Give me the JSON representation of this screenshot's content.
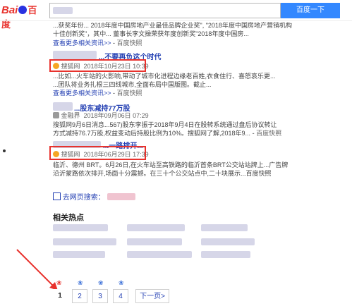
{
  "header": {
    "logo_bai": "Bai",
    "logo_paw": "du",
    "logo_cn": "百度",
    "search_button": "百度一下"
  },
  "results": [
    {
      "snippet_line1": "...获奖年份... 2018年度中国房地产业最佳品牌企业奖\", \"2018年度中国房地产营销机构",
      "snippet_line2": "十佳创新奖\"，其中... 董事长李文操荣获年度创新奖\"2018年度中国房...",
      "more_label": "查看更多相关资讯>>",
      "snapshot": "百度快照"
    },
    {
      "title": "...不要再负这个时代",
      "source": "搜狐网",
      "time": "2018年10月23日 10:39",
      "snippet_line1": "...比如...火车站的火影响,带动了城市化进程边缘老百姓,衣食住行、喜怒哀乐更...",
      "snippet_line2": "...团队将业务扎根三四线城市,全面布局中国版图。截止...",
      "more_label": "查看更多相关资讯>>",
      "snapshot": "百度快照"
    },
    {
      "title": "...股东减持77万股",
      "source": "金融界",
      "time": "2018年09月06日 07:29",
      "snippet_line1": "搜狐网9月6日消息...567)股东李振于2018年9月4日在股转系统通过盘后协议转让",
      "snippet_line2": "方式减持76.7万股,权益变动后持股比例为10%。搜狐网了解,2018年9...",
      "snapshot": "百度快照"
    },
    {
      "title": "...一路排开...",
      "source": "搜狐网",
      "time": "2018年06月29日 17:39",
      "snippet_line1": "临沂、德州 BRT。6月26日,在火车站至高铁路的临沂首条BRT公交站站牌上...广告牌",
      "snippet_line2": "沿沂蒙路依次排开,场面十分震撼。在三十个公交站点中,二十块展示...百度快照"
    }
  ],
  "goto_search": "去网页搜索：",
  "related_heading": "相关热点",
  "pager": {
    "pages": [
      "1",
      "2",
      "3",
      "4"
    ],
    "next": "下一页>"
  },
  "colors": {
    "highlight_box": "#e8322d",
    "link": "#2440b3",
    "arrow": "#e8322d"
  }
}
